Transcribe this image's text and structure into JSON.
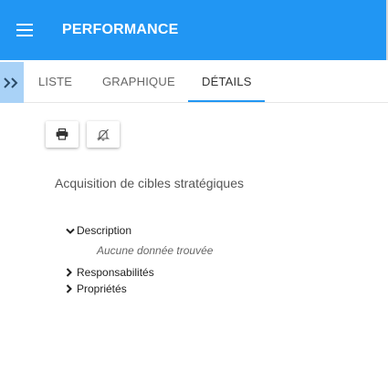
{
  "header": {
    "title": "PERFORMANCE",
    "menu_icon": "hamburger-menu-icon",
    "background_color": "#2196f3"
  },
  "tabs": {
    "expand_icon": "double-chevron-right-icon",
    "items": [
      {
        "label": "LISTE",
        "active": false
      },
      {
        "label": "GRAPHIQUE",
        "active": false
      },
      {
        "label": "DÉTAILS",
        "active": true
      }
    ],
    "accent_color": "#2196f3"
  },
  "toolbar": {
    "print_icon": "print-icon",
    "notifications_off_icon": "bell-off-icon"
  },
  "detail": {
    "title": "Acquisition de cibles stratégiques",
    "sections": [
      {
        "label": "Description",
        "expanded": true,
        "empty_message": "Aucune donnée trouvée"
      },
      {
        "label": "Responsabilités",
        "expanded": false
      },
      {
        "label": "Propriétés",
        "expanded": false
      }
    ]
  }
}
